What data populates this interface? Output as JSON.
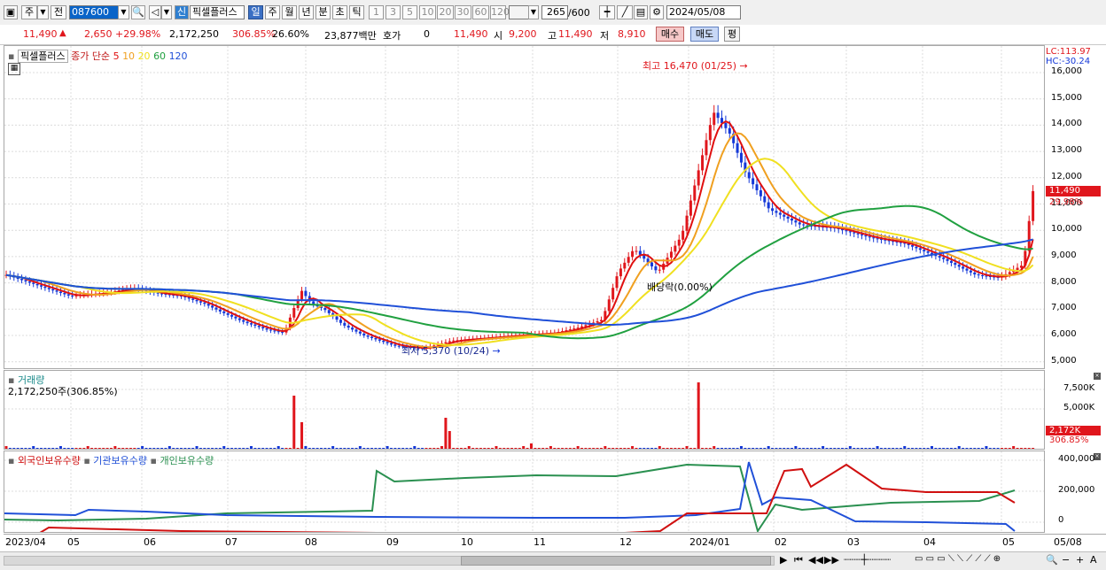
{
  "toolbar": {
    "period_label": "주",
    "prev_label": "전",
    "stock_code": "087600",
    "new_badge": "신",
    "stock_name": "픽셀플러스",
    "periods": [
      "일",
      "주",
      "월",
      "년",
      "분",
      "초",
      "틱"
    ],
    "intervals": [
      "1",
      "3",
      "5",
      "10",
      "20",
      "30",
      "60",
      "120"
    ],
    "count_value": "265",
    "count_total": "/600",
    "date_value": "2024/05/08"
  },
  "quote": {
    "price": "11,490",
    "change": "2,650",
    "change_pct": "+29.98%",
    "volume": "2,172,250",
    "volume_ratio": "306.85%",
    "turnover_pct": "26.60%",
    "amount": "23,877백만",
    "hoga_label": "호가",
    "hoga_value": "0",
    "hoga_price": "11,490",
    "open_label": "시",
    "open": "9,200",
    "high_label": "고",
    "high": "11,490",
    "low_label": "저",
    "low": "8,910",
    "buy_label": "매수",
    "sell_label": "매도",
    "avg_label": "평"
  },
  "price_pane": {
    "legend_name": "픽셀플러스",
    "legend_type": "종가 단순",
    "ma_periods": [
      "5",
      "10",
      "20",
      "60",
      "120"
    ],
    "ma_colors": [
      "#e01010",
      "#f0a020",
      "#f0e020",
      "#20a040",
      "#2050d8"
    ],
    "lc": "LC:113.97",
    "hc": "HC:-30.24",
    "y_labels": [
      "16,000",
      "15,000",
      "14,000",
      "13,000",
      "12,000",
      "11,000",
      "10,000",
      "9,000",
      "8,000",
      "7,000",
      "6,000",
      "5,000"
    ],
    "last_price": "11,490",
    "last_pct": "29.98%",
    "high_annotation": "최고 16,470 (01/25)",
    "low_annotation": "최저 5,370 (10/24)",
    "dividend_annotation": "배당락(0.00%)"
  },
  "volume_pane": {
    "title": "거래량",
    "value": "2,172,250주(306.85%)",
    "y_labels": [
      "7,500K",
      "5,000K"
    ],
    "last_value": "2,172K",
    "last_pct": "306.85%"
  },
  "holding_pane": {
    "legend": [
      "외국인보유수량",
      "기관보유수량",
      "개인보유수량"
    ],
    "legend_colors": [
      "#d01010",
      "#2050d8",
      "#2a9050"
    ],
    "y_labels": [
      "400,000",
      "200,000",
      "0"
    ]
  },
  "x_axis": [
    "2023/04",
    "05",
    "06",
    "07",
    "08",
    "09",
    "10",
    "11",
    "12",
    "2024/01",
    "02",
    "03",
    "04",
    "05",
    "05/08"
  ]
}
